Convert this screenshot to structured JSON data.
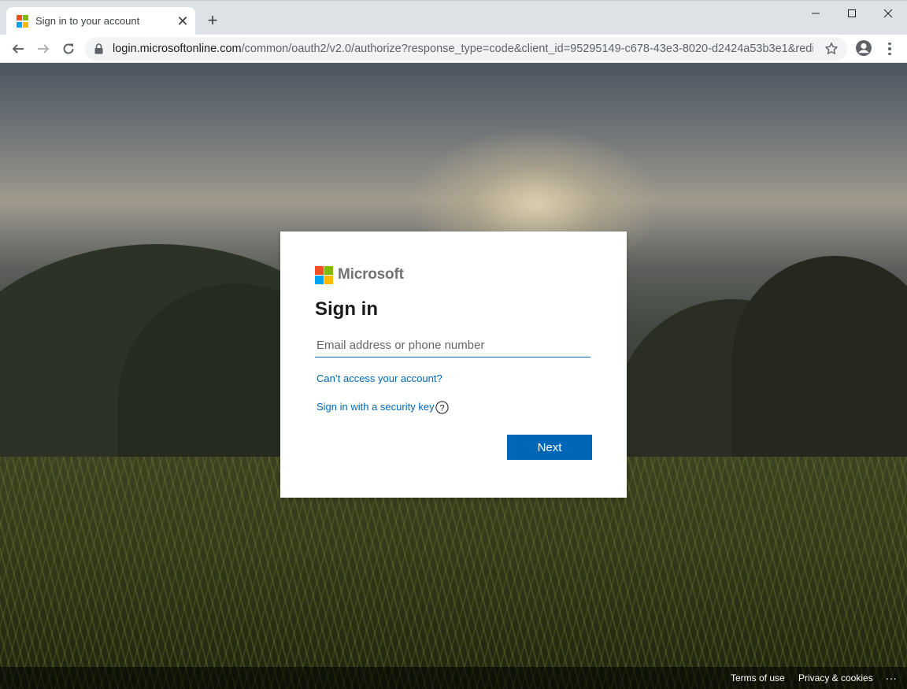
{
  "browser": {
    "tab_title": "Sign in to your account",
    "tab_close": "✕",
    "new_tab": "+",
    "url_host": "login.microsoftonline.com",
    "url_path": "/common/oauth2/v2.0/authorize?response_type=code&client_id=95295149-c678-43e3-8020-d2424a53b3e1&redire...",
    "icons": [
      "back-arrow-icon",
      "forward-arrow-icon",
      "reload-icon",
      "lock-icon",
      "star-icon",
      "profile-icon",
      "menu-icon",
      "minimize-icon",
      "maximize-icon",
      "close-window-icon"
    ]
  },
  "signin": {
    "brand": "Microsoft",
    "title": "Sign in",
    "email_placeholder": "Email address or phone number",
    "email_value": "",
    "cant_access_link": "Can’t access your account?",
    "security_key_link": "Sign in with a security key",
    "next_button": "Next",
    "help_icon": "?"
  },
  "footer": {
    "terms": "Terms of use",
    "privacy": "Privacy & cookies",
    "more": "..."
  },
  "colors": {
    "accent": "#0067b8",
    "ms_red": "#f25022",
    "ms_green": "#7fba00",
    "ms_blue": "#00a4ef",
    "ms_yellow": "#ffb900"
  }
}
